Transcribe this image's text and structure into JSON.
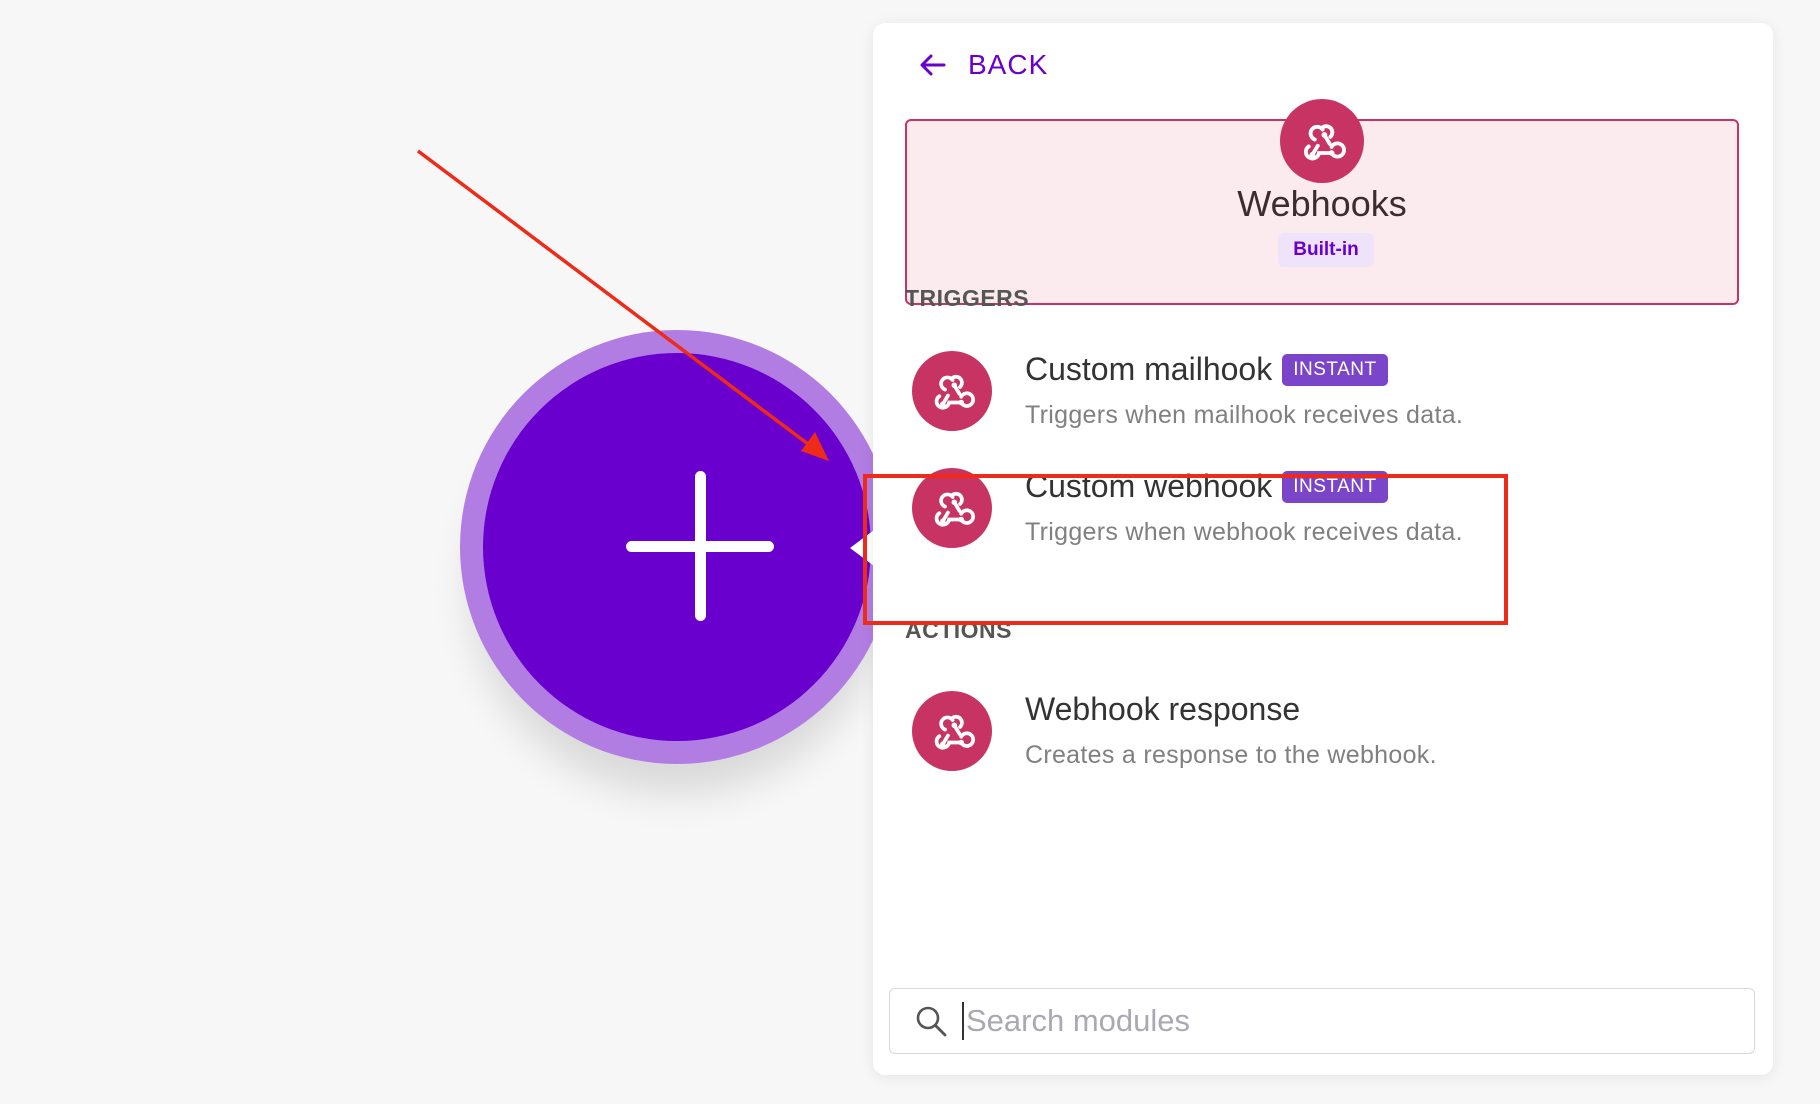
{
  "panel": {
    "back_label": "BACK",
    "app": {
      "name": "Webhooks",
      "badge": "Built-in",
      "icon": "webhook-icon"
    },
    "sections": {
      "triggers_label": "TRIGGERS",
      "actions_label": "ACTIONS"
    },
    "modules": [
      {
        "title": "Custom mailhook",
        "badge": "INSTANT",
        "description": "Triggers when mailhook receives data.",
        "icon": "webhook-icon"
      },
      {
        "title": "Custom webhook",
        "badge": "INSTANT",
        "description": "Triggers when webhook receives data.",
        "icon": "webhook-icon"
      },
      {
        "title": "Webhook response",
        "badge": "",
        "description": "Creates a response to the webhook.",
        "icon": "webhook-icon"
      }
    ],
    "search": {
      "placeholder": "Search modules",
      "value": ""
    }
  },
  "canvas": {
    "add_node_icon": "plus-icon"
  },
  "colors": {
    "accent": "#6a00ce",
    "webhooks_brand": "#c73463",
    "instant_badge": "#7a45c8",
    "annotation": "#ee2a18"
  }
}
